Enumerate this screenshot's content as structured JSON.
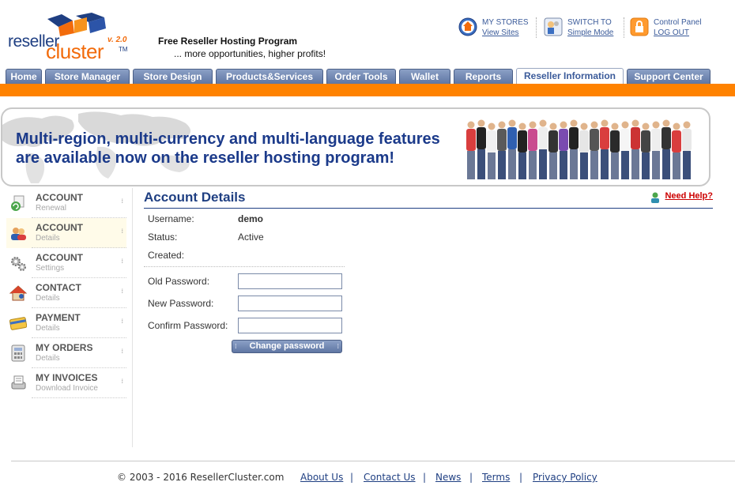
{
  "brand": {
    "word1": "reseller",
    "word2": "cluster",
    "tm": "TM",
    "version": "v. 2.0",
    "tagline_title": "Free Reseller Hosting Program",
    "tagline_sub": "... more opportunities, higher profits!",
    "colors": {
      "navy": "#1f3f82",
      "orange": "#ff8200"
    }
  },
  "toplinks": [
    {
      "line1": "MY STORES",
      "line2": "View Sites",
      "icon": "globe-home-icon"
    },
    {
      "line1": "SWITCH TO",
      "line2": "Simple Mode",
      "icon": "switch-mode-icon"
    },
    {
      "line1": "Control Panel",
      "line2": "LOG OUT",
      "icon": "lock-icon"
    }
  ],
  "tabs": [
    {
      "label": "Home",
      "active": false
    },
    {
      "label": "Store Manager",
      "active": false
    },
    {
      "label": "Store Design",
      "active": false
    },
    {
      "label": "Products&Services",
      "active": false
    },
    {
      "label": "Order Tools",
      "active": false
    },
    {
      "label": "Wallet",
      "active": false
    },
    {
      "label": "Reports",
      "active": false
    },
    {
      "label": "Reseller Information",
      "active": true
    },
    {
      "label": "Support Center",
      "active": false
    }
  ],
  "banner": {
    "line1": "Multi-region, multi-currency and multi-language features",
    "line2": "are available now on the reseller hosting program!"
  },
  "sidebar": [
    {
      "title": "ACCOUNT",
      "sub": "Renewal",
      "icon": "renewal-icon",
      "active": false
    },
    {
      "title": "ACCOUNT",
      "sub": "Details",
      "icon": "users-icon",
      "active": true
    },
    {
      "title": "ACCOUNT",
      "sub": "Settings",
      "icon": "gears-icon",
      "active": false
    },
    {
      "title": "CONTACT",
      "sub": "Details",
      "icon": "house-contact-icon",
      "active": false
    },
    {
      "title": "PAYMENT",
      "sub": "Details",
      "icon": "credit-card-icon",
      "active": false
    },
    {
      "title": "MY ORDERS",
      "sub": "Details",
      "icon": "calculator-icon",
      "active": false
    },
    {
      "title": "MY INVOICES",
      "sub": "Download Invoice",
      "icon": "invoice-icon",
      "active": false
    }
  ],
  "main": {
    "title": "Account Details",
    "help": "Need Help?",
    "username_label": "Username:",
    "username_value": "demo",
    "status_label": "Status:",
    "status_value": "Active",
    "created_label": "Created:",
    "created_value": "",
    "old_password_label": "Old Password:",
    "new_password_label": "New Password:",
    "confirm_password_label": "Confirm Password:",
    "old_password_value": "",
    "new_password_value": "",
    "confirm_password_value": "",
    "change_button": "Change password"
  },
  "footer": {
    "copyright": "© 2003 - 2016 ResellerCluster.com",
    "links": [
      "About Us",
      "Contact Us",
      "News",
      "Terms",
      "Privacy Policy"
    ],
    "separator": "|"
  }
}
